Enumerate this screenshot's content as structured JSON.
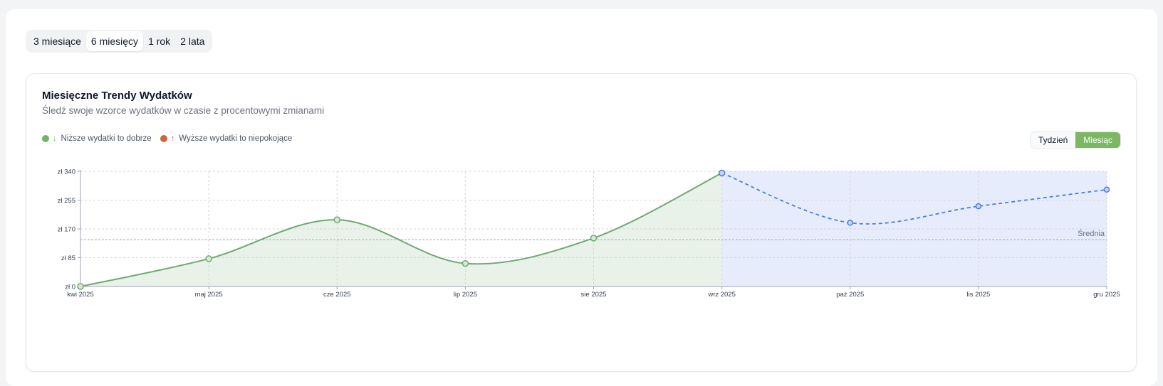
{
  "period_tabs": [
    {
      "label": "3 miesiące",
      "active": false
    },
    {
      "label": "6 miesięcy",
      "active": true
    },
    {
      "label": "1 rok",
      "active": false
    },
    {
      "label": "2 lata",
      "active": false
    }
  ],
  "card": {
    "title": "Miesięczne Trendy Wydatków",
    "subtitle": "Śledź swoje wzorce wydatków w czasie z procentowymi zmianami"
  },
  "legend": {
    "good": {
      "arrow": "↓",
      "label": "Niższe wydatki to dobrze",
      "color": "#6fb563"
    },
    "bad": {
      "arrow": "↑",
      "label": "Wyższe wydatki to niepokojące",
      "color": "#d0623d"
    }
  },
  "toggle": {
    "week": "Tydzień",
    "month": "Miesiąc",
    "active": "month",
    "active_color": "#7cb863"
  },
  "colors": {
    "actual": "#6fa874",
    "actual_fill": "#e9f2e8",
    "forecast": "#4f7be0",
    "forecast_fill": "#e6ecfb",
    "grid": "#d4d4d8"
  },
  "chart_data": {
    "type": "line",
    "categories": [
      "kwi 2025",
      "maj 2025",
      "cze 2025",
      "lip 2025",
      "sie 2025",
      "wrz 2025",
      "paź 2025",
      "lis 2025",
      "gru 2025"
    ],
    "y_ticks": [
      "zł 0",
      "zł 85",
      "zł 170",
      "zł 255",
      "zł 340"
    ],
    "ylim": [
      0,
      340
    ],
    "series": [
      {
        "kind": "actual",
        "values": [
          0,
          82,
          197,
          68,
          143,
          335,
          null,
          null,
          null
        ]
      },
      {
        "kind": "forecast",
        "values": [
          null,
          null,
          null,
          null,
          null,
          335,
          188,
          237,
          286
        ]
      }
    ],
    "average": {
      "label": "Średnia",
      "value": 138
    },
    "grid": true
  }
}
